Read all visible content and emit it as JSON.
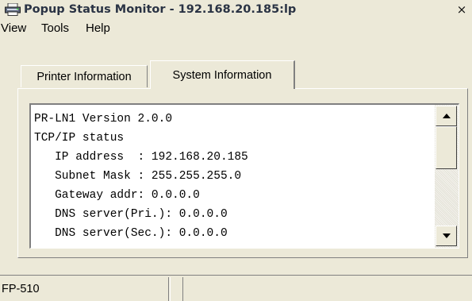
{
  "window": {
    "title": "Popup Status Monitor - 192.168.20.185:lp",
    "close_glyph": "×",
    "icon": "printer-icon"
  },
  "menu": {
    "items": [
      {
        "label": "View"
      },
      {
        "label": "Tools"
      },
      {
        "label": "Help"
      }
    ]
  },
  "tabs": [
    {
      "label": "Printer Information",
      "selected": false
    },
    {
      "label": "System Information",
      "selected": true
    }
  ],
  "system_info": {
    "lines": [
      "PR-LN1 Version 2.0.0",
      "TCP/IP status",
      "   IP address  : 192.168.20.185",
      "   Subnet Mask : 255.255.255.0",
      "   Gateway addr: 0.0.0.0",
      "   DNS server(Pri.): 0.0.0.0",
      "   DNS server(Sec.): 0.0.0.0"
    ]
  },
  "scrollbar": {
    "up_icon": "scroll-up-arrow-icon",
    "down_icon": "scroll-down-arrow-icon"
  },
  "statusbar": {
    "model": "FP-510",
    "message": ""
  }
}
